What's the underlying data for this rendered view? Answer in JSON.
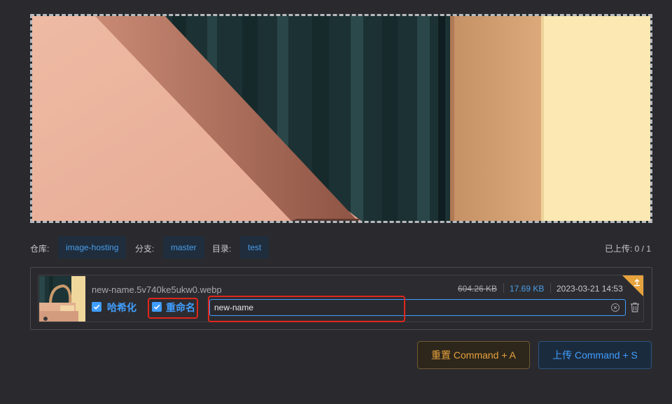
{
  "preview": {
    "image_alt": "artwork preview",
    "colors": {
      "pink": "#e9b8a0",
      "dark_green": "#1d3436",
      "tan": "#d1a275",
      "cream": "#fbe7b0"
    }
  },
  "meta": {
    "repo_label": "仓库:",
    "repo_value": "image-hosting",
    "branch_label": "分支:",
    "branch_value": "master",
    "dir_label": "目录:",
    "dir_value": "test",
    "uploaded_label": "已上传: 0 / 1"
  },
  "file": {
    "name": "new-name.5v740ke5ukw0.webp",
    "original_size": "604.26 KB",
    "compressed_size": "17.69 KB",
    "date": "2023-03-21 14:53",
    "hash_label": "哈希化",
    "hash_checked": true,
    "rename_label": "重命名",
    "rename_checked": true,
    "rename_value": "new-name",
    "corner_icon": "upload-arrow-icon"
  },
  "buttons": {
    "reset": "重置 Command + A",
    "upload": "上传 Command + S"
  },
  "colors": {
    "accent_blue": "#409eff",
    "warning_orange": "#e6a23c",
    "highlight_red": "#e0261b",
    "background": "#2a2a2e"
  }
}
